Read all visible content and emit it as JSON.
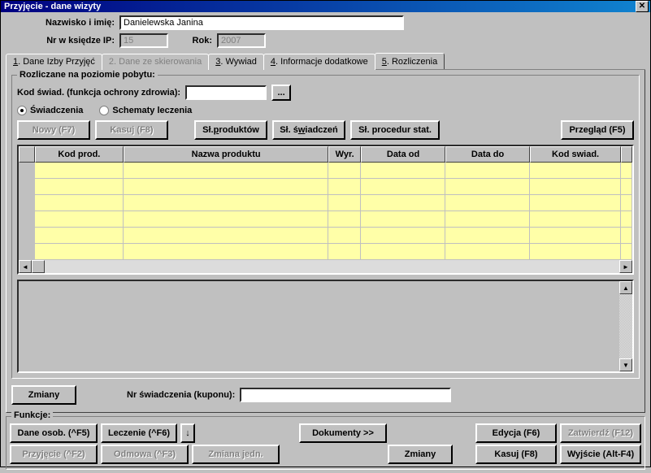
{
  "window": {
    "title": "Przyjęcie - dane wizyty"
  },
  "header": {
    "name_label": "Nazwisko i imię:",
    "name_value": "Danielewska Janina",
    "nr_label": "Nr w księdze IP:",
    "nr_value": "15",
    "rok_label": "Rok:",
    "rok_value": "2007"
  },
  "tabs": {
    "t1": "1. Dane Izby Przyjęć",
    "t2": "2. Dane ze skierowania",
    "t3": "3. Wywiad",
    "t4": "4. Informacje dodatkowe",
    "t5": "5. Rozliczenia"
  },
  "groupbox": {
    "legend": "Rozliczane na poziomie pobytu:",
    "kod_label": "Kod świad. (funkcja ochrony zdrowia):",
    "kod_value": "",
    "btn_dots": "...",
    "radio_swiad": "Świadczenia",
    "radio_schematy": "Schematy leczenia",
    "btn_nowy": "Nowy (F7)",
    "btn_kasuj": "Kasuj (F8)",
    "btn_sl_prod": "Sł. produktów",
    "btn_sl_swiad": "Sł. świadczeń",
    "btn_sl_proc": "Sł. procedur stat.",
    "btn_przeglad": "Przegląd (F5)"
  },
  "table": {
    "cols": {
      "kodprod": "Kod prod.",
      "nazwa": "Nazwa produktu",
      "wyr": "Wyr.",
      "dataod": "Data od",
      "datado": "Data do",
      "kodswiad": "Kod swiad."
    }
  },
  "bottom": {
    "zmiany": "Zmiany",
    "nr_swiad_label": "Nr świadczenia (kuponu):",
    "nr_swiad_value": ""
  },
  "funkcje": {
    "legend": "Funkcje:",
    "dane_osob": "Dane osob. (^F5)",
    "leczenie": "Leczenie (^F6)",
    "arrow": "↓",
    "dokumenty": "Dokumenty >>",
    "edycja": "Edycja (F6)",
    "zatwierdz": "Zatwierdź (F12)",
    "przyjecie": "Przyjęcie (^F2)",
    "odmowa": "Odmowa (^F3)",
    "zmiana_jedn": "Zmiana jedn.",
    "zmiany2": "Zmiany",
    "kasuj2": "Kasuj (F8)",
    "wyjscie": "Wyjście (Alt-F4)"
  }
}
